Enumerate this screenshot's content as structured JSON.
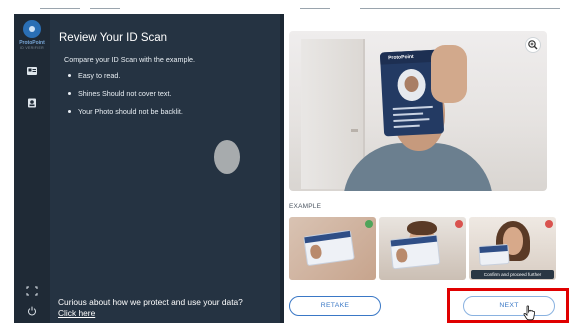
{
  "app": {
    "brand_name": "ProtoPoint",
    "brand_sub": "ID VERIFIER"
  },
  "panel": {
    "title": "Review Your ID Scan",
    "intro": "Compare your ID Scan with the example.",
    "bullets": [
      "Easy to read.",
      "Shines Should not cover text.",
      "Your Photo should not be backlit."
    ],
    "footer_question": "Curious about how we protect and use your data?",
    "footer_link": "Click here"
  },
  "review": {
    "card_brand": "ProtoPoint",
    "example_label": "EXAMPLE",
    "examples": [
      {
        "status": "ok"
      },
      {
        "status": "bad"
      },
      {
        "status": "bad",
        "tooltip": "Confirm and proceed further"
      }
    ],
    "retake_label": "RETAKE",
    "next_label": "NEXT"
  },
  "icons": {
    "logo": "eye-logo-icon",
    "nav_1": "id-card-icon",
    "nav_2": "portrait-icon",
    "fullscreen": "fullscreen-icon",
    "power": "power-icon",
    "zoom": "zoom-in-icon",
    "cursor": "hand-pointer-icon"
  },
  "colors": {
    "rail": "#1f2a36",
    "panel": "#253342",
    "accent": "#3a78c6",
    "highlight": "#e00000",
    "ok": "#4fa45a",
    "bad": "#d9534f"
  }
}
